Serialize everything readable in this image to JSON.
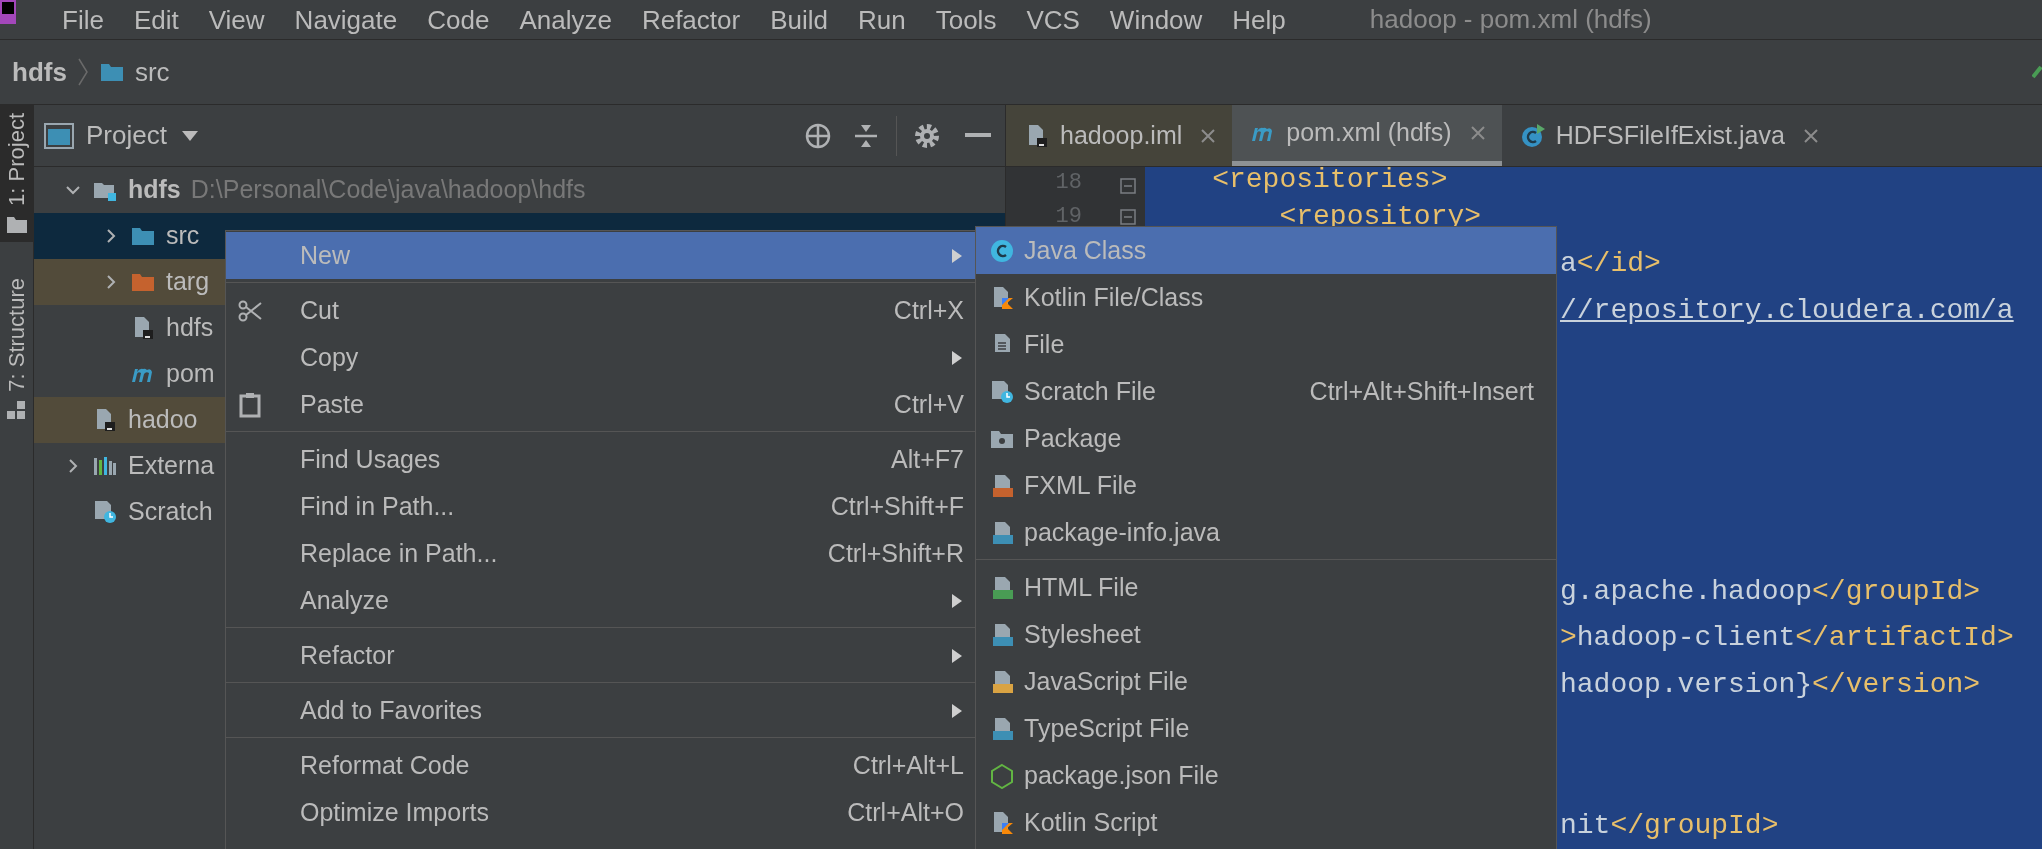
{
  "menu_bar": {
    "items": [
      "File",
      "Edit",
      "View",
      "Navigate",
      "Code",
      "Analyze",
      "Refactor",
      "Build",
      "Run",
      "Tools",
      "VCS",
      "Window",
      "Help"
    ],
    "title": "hadoop - pom.xml (hdfs)"
  },
  "breadcrumb": [
    {
      "label": "hdfs",
      "kind": "module"
    },
    {
      "label": "src",
      "kind": "folder"
    }
  ],
  "tool_strip": [
    {
      "label": "1: Project",
      "selected": true
    },
    {
      "label": "7: Structure",
      "selected": false
    }
  ],
  "project_panel": {
    "title": "Project",
    "tree": [
      {
        "label": "hdfs",
        "path": "D:\\Personal\\Code\\java\\hadoop\\hdfs",
        "kind": "module",
        "expanded": true,
        "selected": false,
        "highlighted": false,
        "children": [
          {
            "label": "src",
            "kind": "folder",
            "expanded": false,
            "selected": true,
            "highlighted": false
          },
          {
            "label": "targ",
            "kind": "excluded-folder",
            "expanded": false,
            "selected": false,
            "highlighted": true
          },
          {
            "label": "hdfs",
            "kind": "iml",
            "selected": false,
            "highlighted": false
          },
          {
            "label": "pom",
            "kind": "maven",
            "selected": false,
            "highlighted": false
          }
        ]
      },
      {
        "label": "hadoo",
        "kind": "iml",
        "selected": false,
        "highlighted": true
      },
      {
        "label": "Externa",
        "kind": "libraries",
        "expanded": false,
        "selected": false,
        "highlighted": false
      },
      {
        "label": "Scratch",
        "kind": "scratches",
        "selected": false,
        "highlighted": false
      }
    ]
  },
  "editor": {
    "tabs": [
      {
        "label": "hadoop.iml",
        "kind": "iml",
        "selected": false
      },
      {
        "label": "pom.xml (hdfs)",
        "kind": "maven",
        "selected": true
      },
      {
        "label": "HDFSFileIfExist.java",
        "kind": "java-class",
        "selected": false
      }
    ],
    "lines": [
      {
        "number": "18",
        "kind": "full",
        "segments": [
          {
            "kind": "tag",
            "text": "    <repositories>"
          }
        ]
      },
      {
        "number": "19",
        "kind": "full",
        "segments": [
          {
            "kind": "tag",
            "text": "        <repository>"
          }
        ]
      },
      {
        "kind": "covered",
        "segments": [
          {
            "kind": "text",
            "text": "a"
          },
          {
            "kind": "tag",
            "text": "</id>"
          }
        ]
      },
      {
        "kind": "covered",
        "segments": [
          {
            "kind": "link",
            "text": "//repository.cloudera.com/a"
          }
        ]
      },
      {
        "kind": "blank"
      },
      {
        "kind": "blank"
      },
      {
        "kind": "blank"
      },
      {
        "kind": "blank"
      },
      {
        "kind": "blank"
      },
      {
        "kind": "covered",
        "segments": [
          {
            "kind": "text",
            "text": "g.apache.hadoop"
          },
          {
            "kind": "tag",
            "text": "</groupId>"
          }
        ]
      },
      {
        "kind": "covered",
        "segments": [
          {
            "kind": "tag",
            "text": ">"
          },
          {
            "kind": "text",
            "text": "hadoop-client"
          },
          {
            "kind": "tag",
            "text": "</artifactId>"
          }
        ]
      },
      {
        "kind": "covered",
        "segments": [
          {
            "kind": "text",
            "text": "hadoop.version}"
          },
          {
            "kind": "tag",
            "text": "</version>"
          }
        ]
      },
      {
        "kind": "blank"
      },
      {
        "kind": "blank"
      },
      {
        "kind": "covered",
        "segments": [
          {
            "kind": "text",
            "text": "nit"
          },
          {
            "kind": "tag",
            "text": "</groupId>"
          }
        ]
      }
    ]
  },
  "context_menu": {
    "groups": [
      [
        {
          "label": "New",
          "kind": "plain",
          "has_submenu": true,
          "selected": true
        }
      ],
      [
        {
          "label": "Cut",
          "kind": "cut",
          "shortcut": "Ctrl+X",
          "has_submenu": false,
          "selected": false
        },
        {
          "label": "Copy",
          "kind": "plain",
          "has_submenu": true,
          "selected": false
        },
        {
          "label": "Paste",
          "kind": "paste",
          "shortcut": "Ctrl+V",
          "has_submenu": false,
          "selected": false
        }
      ],
      [
        {
          "label": "Find Usages",
          "kind": "plain",
          "shortcut": "Alt+F7",
          "has_submenu": false,
          "selected": false
        },
        {
          "label": "Find in Path...",
          "kind": "plain",
          "shortcut": "Ctrl+Shift+F",
          "has_submenu": false,
          "selected": false
        },
        {
          "label": "Replace in Path...",
          "kind": "plain",
          "shortcut": "Ctrl+Shift+R",
          "has_submenu": false,
          "selected": false
        },
        {
          "label": "Analyze",
          "kind": "plain",
          "has_submenu": true,
          "selected": false
        }
      ],
      [
        {
          "label": "Refactor",
          "kind": "plain",
          "has_submenu": true,
          "selected": false
        }
      ],
      [
        {
          "label": "Add to Favorites",
          "kind": "plain",
          "has_submenu": true,
          "selected": false
        }
      ],
      [
        {
          "label": "Reformat Code",
          "kind": "plain",
          "shortcut": "Ctrl+Alt+L",
          "has_submenu": false,
          "selected": false
        },
        {
          "label": "Optimize Imports",
          "kind": "plain",
          "shortcut": "Ctrl+Alt+O",
          "has_submenu": false,
          "selected": false
        }
      ]
    ]
  },
  "submenu": {
    "groups": [
      [
        {
          "label": "Java Class",
          "kind": "class",
          "selected": true
        },
        {
          "label": "Kotlin File/Class",
          "kind": "kotlin",
          "selected": false
        },
        {
          "label": "File",
          "kind": "file",
          "selected": false
        },
        {
          "label": "Scratch File",
          "kind": "scratch",
          "shortcut": "Ctrl+Alt+Shift+Insert",
          "selected": false
        },
        {
          "label": "Package",
          "kind": "package",
          "selected": false
        },
        {
          "label": "FXML File",
          "kind": "fxml",
          "selected": false
        },
        {
          "label": "package-info.java",
          "kind": "java-file",
          "selected": false
        }
      ],
      [
        {
          "label": "HTML File",
          "kind": "html",
          "selected": false
        },
        {
          "label": "Stylesheet",
          "kind": "css",
          "selected": false
        },
        {
          "label": "JavaScript File",
          "kind": "js",
          "selected": false
        },
        {
          "label": "TypeScript File",
          "kind": "ts",
          "selected": false
        },
        {
          "label": "package.json File",
          "kind": "npm",
          "selected": false
        },
        {
          "label": "Kotlin Script",
          "kind": "kotlin-script",
          "selected": false
        }
      ]
    ]
  }
}
